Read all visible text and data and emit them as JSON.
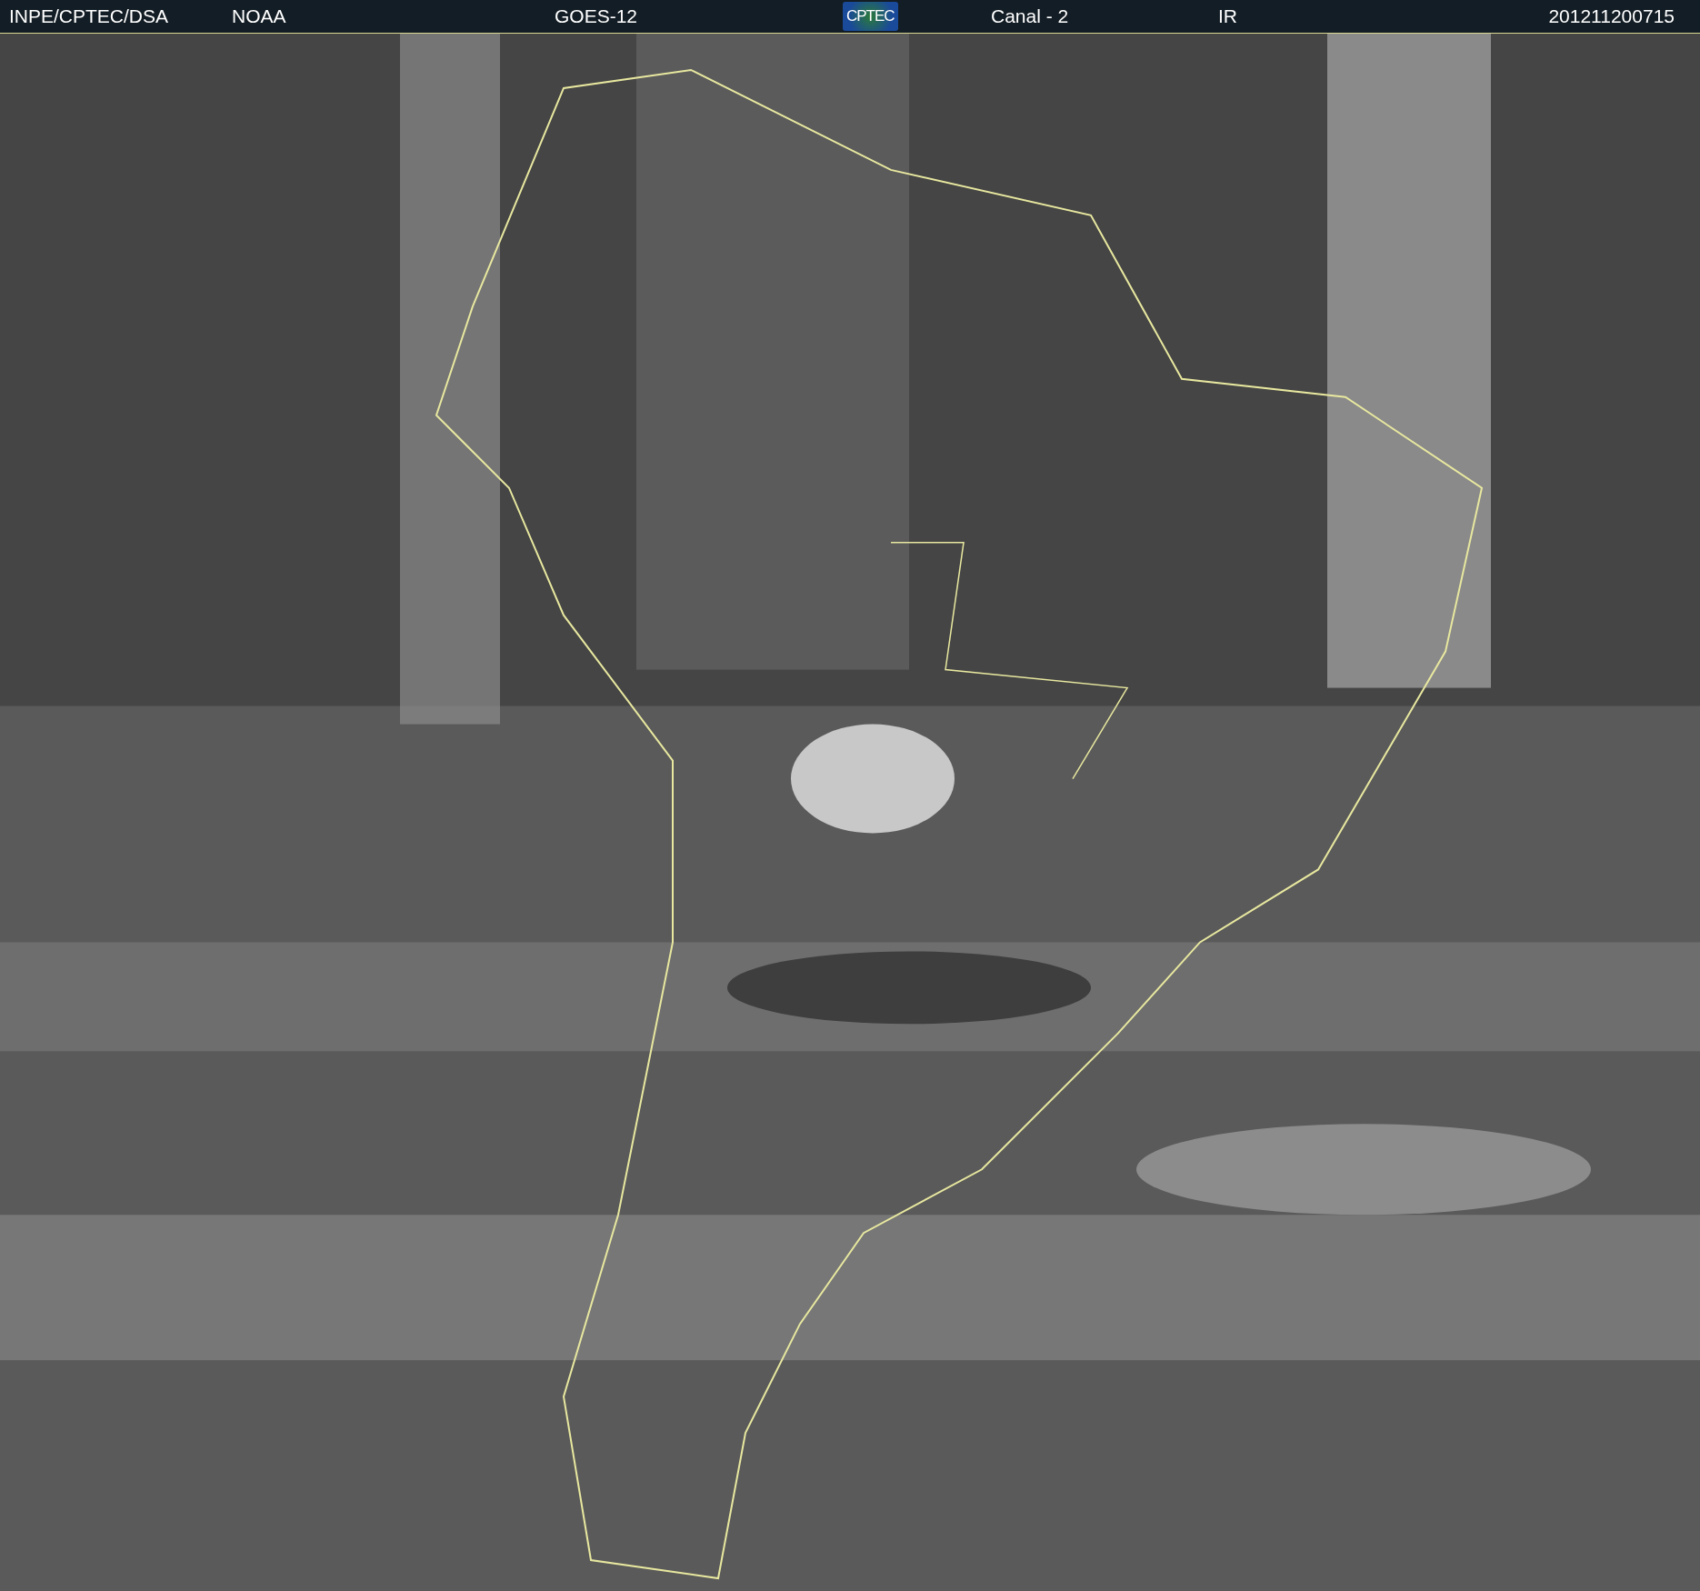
{
  "header": {
    "source": "INPE/CPTEC/DSA",
    "agency": "NOAA",
    "satellite": "GOES-12",
    "logo": "CPTEC",
    "channel": "Canal - 2",
    "band": "IR",
    "timestamp": "201211200715"
  }
}
